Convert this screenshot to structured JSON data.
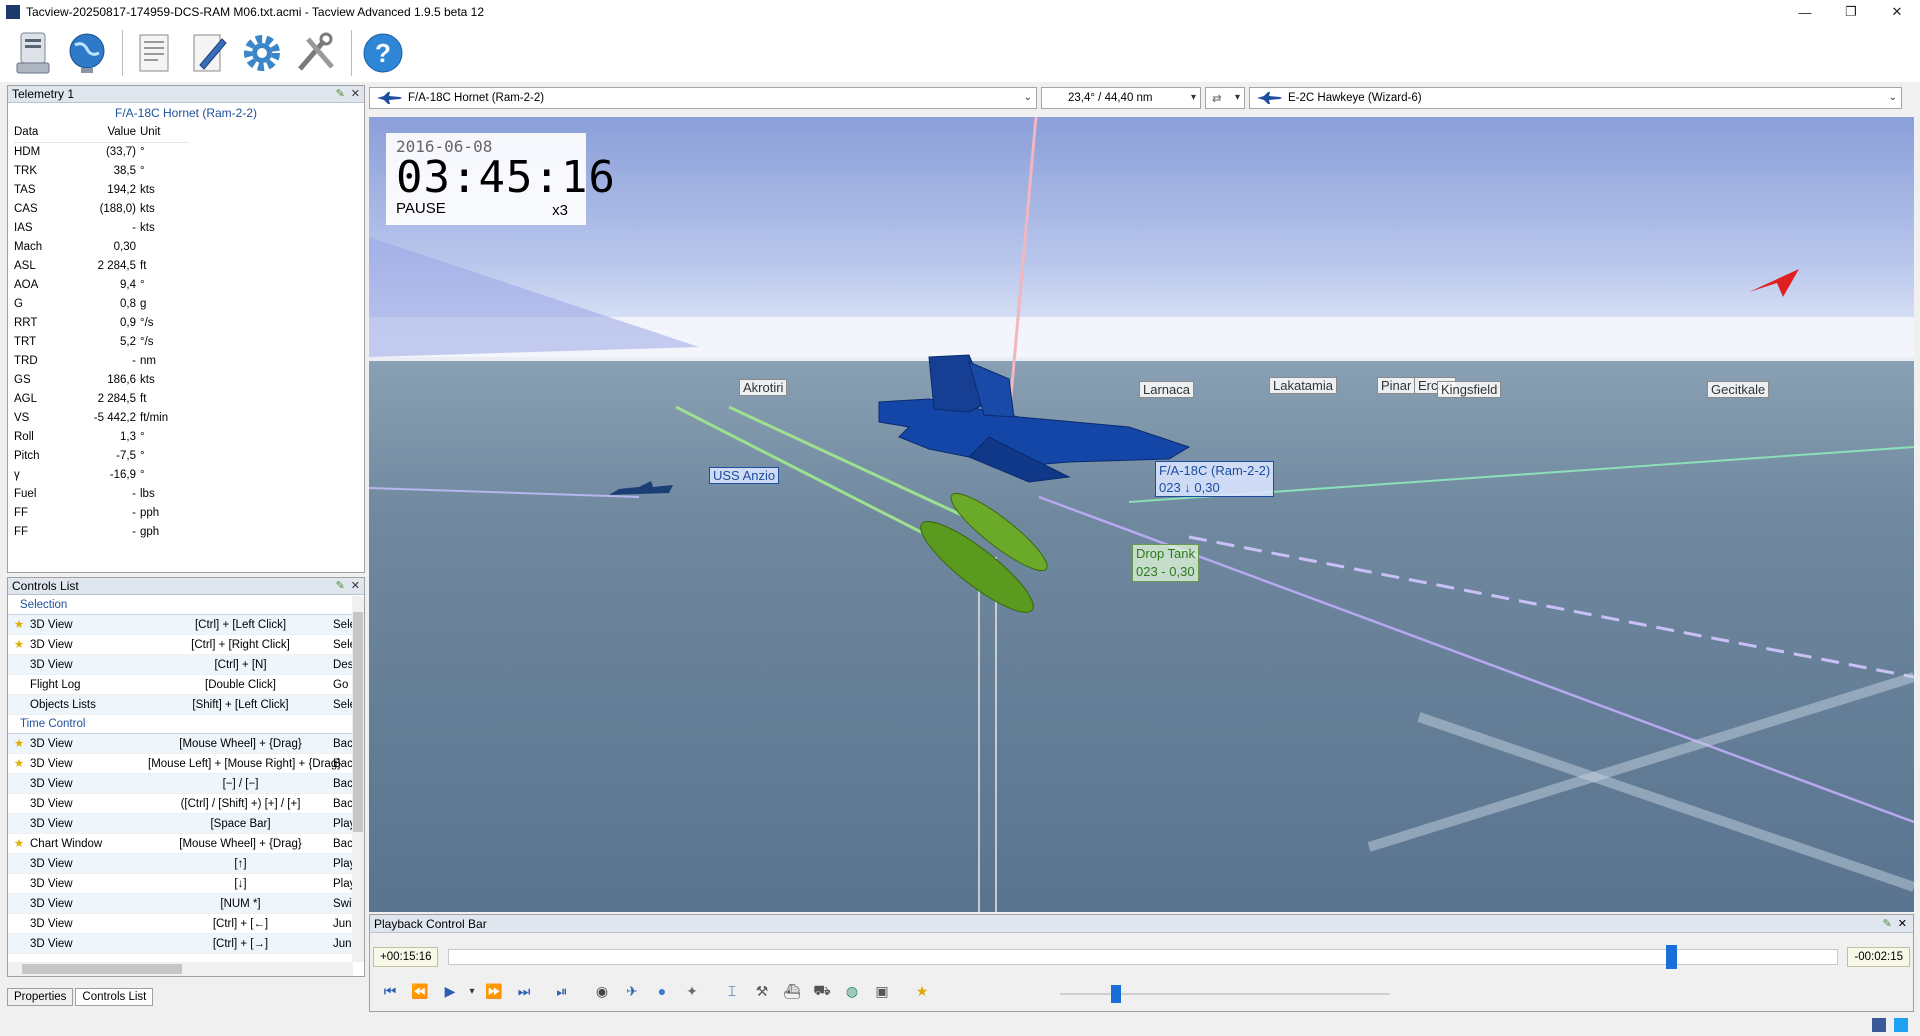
{
  "window": {
    "title": "Tacview-20250817-174959-DCS-RAM M06.txt.acmi - Tacview Advanced 1.9.5 beta 12",
    "minimize": "—",
    "restore": "❐",
    "close": "✕"
  },
  "toolbar": {
    "icons": [
      "recorder-icon",
      "globe-icon",
      "document-icon",
      "edit-icon",
      "settings-icon",
      "tools-icon",
      "help-icon"
    ]
  },
  "telemetry": {
    "title": "Telemetry 1",
    "object": "F/A-18C Hornet (Ram-2-2)",
    "headers": {
      "data": "Data",
      "value": "Value",
      "unit": "Unit"
    },
    "rows": [
      {
        "d": "HDM",
        "v": "(33,7)",
        "u": "°"
      },
      {
        "d": "TRK",
        "v": "38,5",
        "u": "°"
      },
      {
        "d": "TAS",
        "v": "194,2",
        "u": "kts"
      },
      {
        "d": "CAS",
        "v": "(188,0)",
        "u": "kts"
      },
      {
        "d": "IAS",
        "v": "-",
        "u": "kts"
      },
      {
        "d": "Mach",
        "v": "0,30",
        "u": ""
      },
      {
        "d": "ASL",
        "v": "2 284,5",
        "u": "ft"
      },
      {
        "d": "AOA",
        "v": "9,4",
        "u": "°"
      },
      {
        "d": "G",
        "v": "0,8",
        "u": "g"
      },
      {
        "d": "RRT",
        "v": "0,9",
        "u": "°/s"
      },
      {
        "d": "TRT",
        "v": "5,2",
        "u": "°/s"
      },
      {
        "d": "TRD",
        "v": "-",
        "u": "nm"
      },
      {
        "d": "GS",
        "v": "186,6",
        "u": "kts"
      },
      {
        "d": "AGL",
        "v": "2 284,5",
        "u": "ft"
      },
      {
        "d": "VS",
        "v": "-5 442,2",
        "u": "ft/min"
      },
      {
        "d": "Roll",
        "v": "1,3",
        "u": "°"
      },
      {
        "d": "Pitch",
        "v": "-7,5",
        "u": "°"
      },
      {
        "d": "γ",
        "v": "-16,9",
        "u": "°"
      },
      {
        "d": "Fuel",
        "v": "-",
        "u": "lbs"
      },
      {
        "d": "FF",
        "v": "-",
        "u": "pph"
      },
      {
        "d": "FF",
        "v": "-",
        "u": "gph"
      }
    ]
  },
  "controls": {
    "title": "Controls List",
    "sections": [
      {
        "name": "Selection",
        "rows": [
          {
            "star": true,
            "ctx": "3D View",
            "key": "[Ctrl] + [Left Click]",
            "act": "Sele"
          },
          {
            "star": true,
            "ctx": "3D View",
            "key": "[Ctrl] + [Right Click]",
            "act": "Sele"
          },
          {
            "star": false,
            "ctx": "3D View",
            "key": "[Ctrl] + [N]",
            "act": "Des"
          },
          {
            "star": false,
            "ctx": "Flight Log",
            "key": "[Double Click]",
            "act": "Go"
          },
          {
            "star": false,
            "ctx": "Objects Lists",
            "key": "[Shift] + [Left Click]",
            "act": "Sele"
          }
        ]
      },
      {
        "name": "Time Control",
        "rows": [
          {
            "star": true,
            "ctx": "3D View",
            "key": "[Mouse Wheel] + {Drag}",
            "act": "Bac"
          },
          {
            "star": true,
            "ctx": "3D View",
            "key": "[Mouse Left] + [Mouse Right] + {Drag}",
            "act": "Bac"
          },
          {
            "star": false,
            "ctx": "3D View",
            "key": "[−] / [−]",
            "act": "Bac"
          },
          {
            "star": false,
            "ctx": "3D View",
            "key": "([Ctrl] / [Shift] +) [+] / [+]",
            "act": "Bac"
          },
          {
            "star": false,
            "ctx": "3D View",
            "key": "[Space Bar]",
            "act": "Play"
          },
          {
            "star": true,
            "ctx": "Chart Window",
            "key": "[Mouse Wheel] + {Drag}",
            "act": "Bac"
          },
          {
            "star": false,
            "ctx": "3D View",
            "key": "[↑]",
            "act": "Play"
          },
          {
            "star": false,
            "ctx": "3D View",
            "key": "[↓]",
            "act": "Play"
          },
          {
            "star": false,
            "ctx": "3D View",
            "key": "[NUM *]",
            "act": "Swi"
          },
          {
            "star": false,
            "ctx": "3D View",
            "key": "[Ctrl] + [←]",
            "act": "Jun"
          },
          {
            "star": false,
            "ctx": "3D View",
            "key": "[Ctrl] + [→]",
            "act": "Jun"
          }
        ]
      }
    ]
  },
  "bottom_tabs": {
    "properties": "Properties",
    "controls": "Controls List"
  },
  "view_header": {
    "primary_object": "F/A-18C Hornet (Ram-2-2)",
    "bearing": "23,4° / 44,40 nm",
    "secondary_object": "E-2C Hawkeye (Wizard-6)"
  },
  "hud": {
    "date": "2016-06-08",
    "time": "03:45:16",
    "state": "PAUSE",
    "speed": "x3"
  },
  "scene_labels": {
    "akrotiri": "Akrotiri",
    "larnaca": "Larnaca",
    "lakatamia": "Lakatamia",
    "pinarbasi": "Pinar",
    "ercan": "Ercan",
    "kingsfield": "Kingsfield",
    "gecitkale": "Gecitkale",
    "ship": "USS Anzio",
    "aircraft_name": "F/A-18C (Ram-2-2)",
    "aircraft_info": "023 ↓ 0,30",
    "tank_name": "Drop Tank",
    "tank_info": "023 - 0,30"
  },
  "playback": {
    "title": "Playback Control Bar",
    "elapsed": "+00:15:16",
    "remaining": "-00:02:15",
    "progress": 0.88,
    "speed_slider": 0.17
  },
  "colors": {
    "panel_title_bg": "#dfe6ee",
    "accent_blue": "#1d4f9a",
    "aircraft_blue": "#1446a8",
    "tank_green": "#5a9a1e"
  }
}
